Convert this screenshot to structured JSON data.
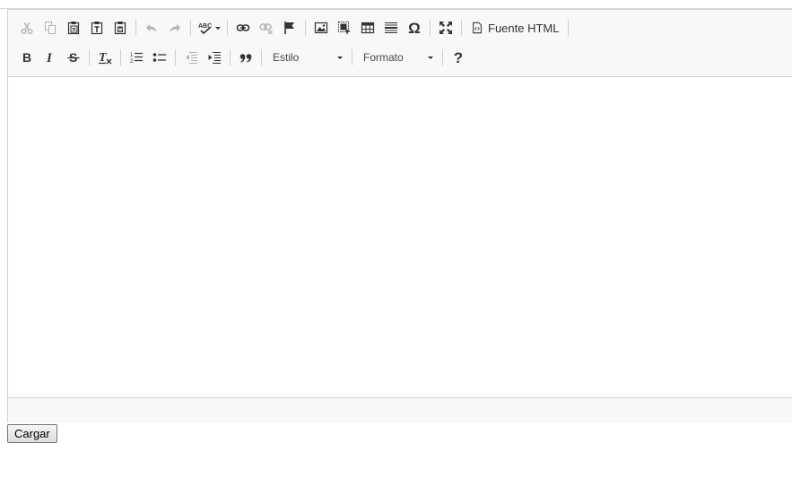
{
  "toolbar": {
    "source_label": "Fuente HTML",
    "style_combo": "Estilo",
    "format_combo": "Formato",
    "help_label": "?",
    "special_char_label": "Ω"
  },
  "submit_label": "Cargar",
  "colors": {
    "toolbar_bg": "#f8f8f8",
    "border": "#d1d1d1",
    "icon": "#333333"
  },
  "icons": [
    "cut-icon",
    "copy-icon",
    "paste-icon",
    "paste-text-icon",
    "paste-word-icon",
    "undo-icon",
    "redo-icon",
    "spellcheck-icon",
    "link-icon",
    "unlink-icon",
    "anchor-flag-icon",
    "image-icon",
    "iframe-icon",
    "table-icon",
    "horizontal-rule-icon",
    "special-char-icon",
    "maximize-icon",
    "source-icon",
    "bold-icon",
    "italic-icon",
    "strike-icon",
    "remove-format-icon",
    "numbered-list-icon",
    "bulleted-list-icon",
    "outdent-icon",
    "indent-icon",
    "blockquote-icon",
    "help-icon"
  ]
}
